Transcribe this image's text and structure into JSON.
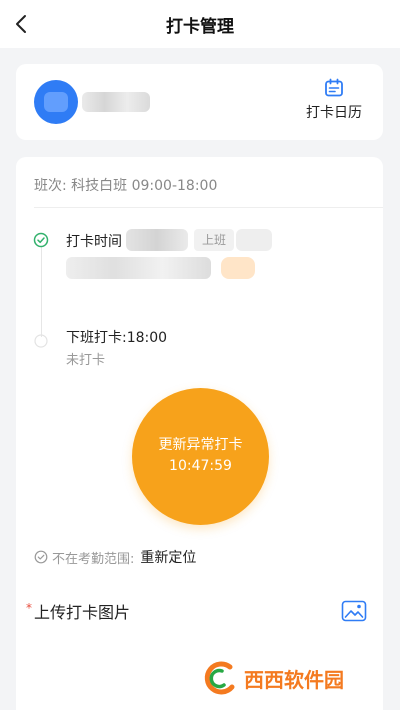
{
  "header": {
    "title": "打卡管理"
  },
  "user_card": {
    "calendar_label": "打卡日历"
  },
  "shift": {
    "text": "班次: 科技白班 09:00-18:00"
  },
  "checkin": {
    "label": "打卡时间",
    "tag": "上班"
  },
  "checkout": {
    "label": "下班打卡:18:00",
    "status": "未打卡"
  },
  "punch": {
    "label": "更新异常打卡",
    "time": "10:47:59"
  },
  "location": {
    "text": "不在考勤范围:",
    "action": "重新定位"
  },
  "upload": {
    "required_mark": "*",
    "label": "上传打卡图片"
  },
  "watermark": {
    "text": "西西软件园"
  },
  "colors": {
    "accent": "#f7a21b",
    "avatar": "#2f7cf5",
    "success": "#32b16c",
    "icon_blue": "#2f7cf5"
  },
  "icons": [
    "back-icon",
    "calendar-icon",
    "check-circle-icon",
    "circle-outline-icon",
    "location-check-icon",
    "image-icon"
  ]
}
